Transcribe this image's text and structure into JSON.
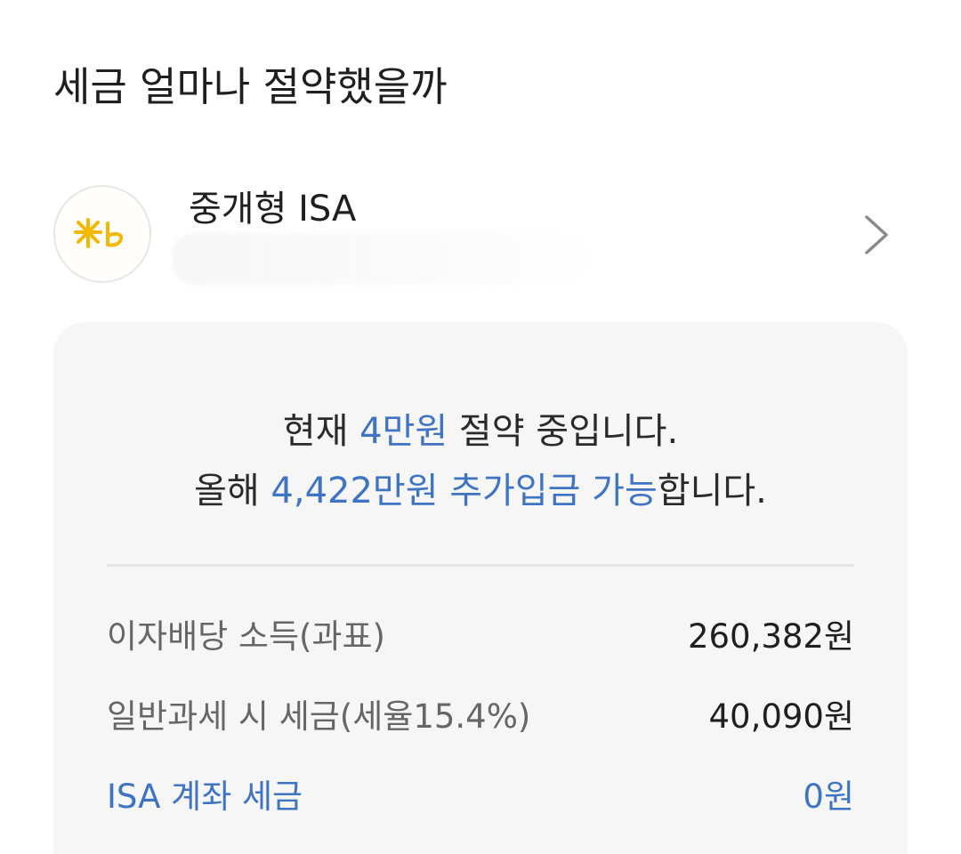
{
  "header": {
    "title": "세금 얼마나 절약했을까"
  },
  "account": {
    "logo_icon": "kb-bank-logo-icon",
    "logo_color": "#f5b800",
    "name": "중개형 ISA",
    "chevron_icon": "chevron-right-icon"
  },
  "summary": {
    "line1": {
      "prefix": "현재 ",
      "amount": "4만원",
      "suffix": " 절약 중입니다."
    },
    "line2": {
      "prefix": "올해 ",
      "amount": "4,422만원 추가입금 가능",
      "suffix": "합니다."
    },
    "accent_color": "#3f74c4"
  },
  "details": [
    {
      "label": "이자배당 소득(과표)",
      "value": "260,382원"
    },
    {
      "label": "일반과세 시 세금(세율15.4%)",
      "value": "40,090원"
    },
    {
      "label": "ISA 계좌 세금",
      "value": "0원"
    }
  ]
}
